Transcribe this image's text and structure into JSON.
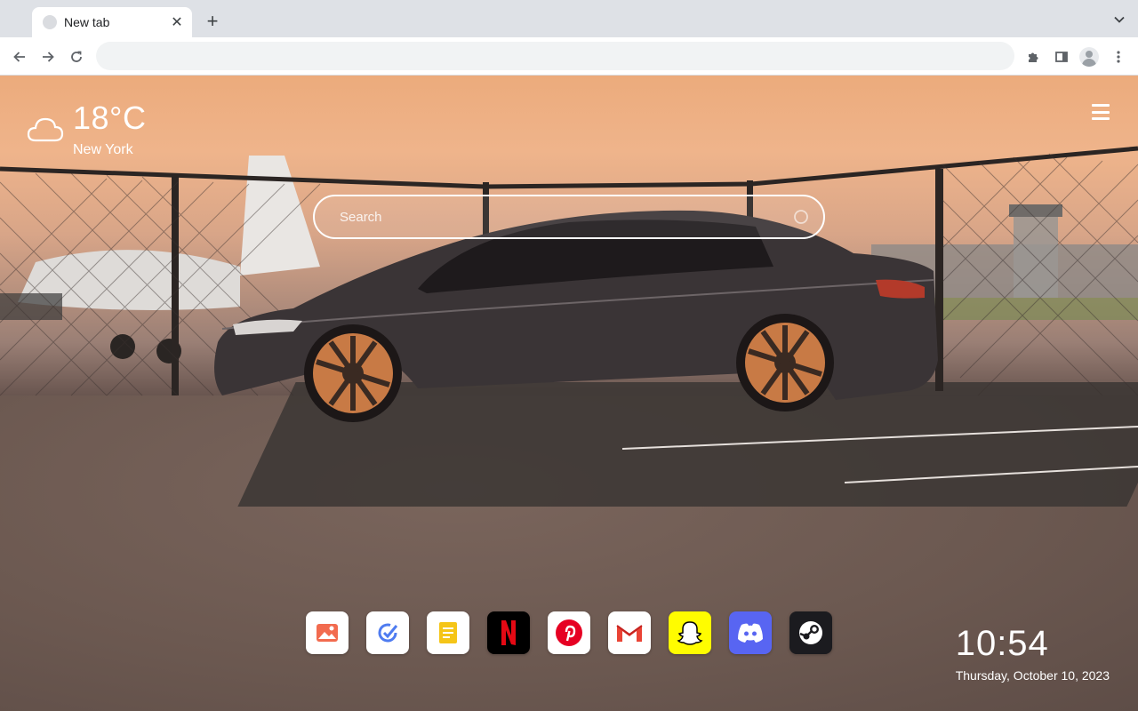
{
  "browser": {
    "tab": {
      "title": "New tab",
      "close_glyph": "✕"
    },
    "new_tab_glyph": "+",
    "omnibox": {
      "value": "",
      "placeholder": ""
    }
  },
  "weather": {
    "temperature": "18°C",
    "city": "New York",
    "icon": "cloud-icon"
  },
  "search": {
    "placeholder": "Search"
  },
  "dock": {
    "apps": [
      {
        "name": "gallery",
        "icon": "image-icon",
        "bg": "#ffffff"
      },
      {
        "name": "tasks",
        "icon": "check-circle-icon",
        "bg": "#ffffff"
      },
      {
        "name": "notes",
        "icon": "note-icon",
        "bg": "#ffffff"
      },
      {
        "name": "netflix",
        "icon": "netflix-icon",
        "bg": "#000000"
      },
      {
        "name": "pinterest",
        "icon": "pinterest-icon",
        "bg": "#ffffff"
      },
      {
        "name": "gmail",
        "icon": "gmail-icon",
        "bg": "#ffffff"
      },
      {
        "name": "snapchat",
        "icon": "snapchat-icon",
        "bg": "#fffc00"
      },
      {
        "name": "discord",
        "icon": "discord-icon",
        "bg": "#5865f2"
      },
      {
        "name": "steam",
        "icon": "steam-icon",
        "bg": "#1b1b1f"
      }
    ]
  },
  "clock": {
    "time": "10:54",
    "date": "Thursday, October 10, 2023"
  },
  "colors": {
    "accent_white": "#ffffff",
    "toolbar": "#ffffff",
    "tabstrip": "#dee1e6"
  }
}
